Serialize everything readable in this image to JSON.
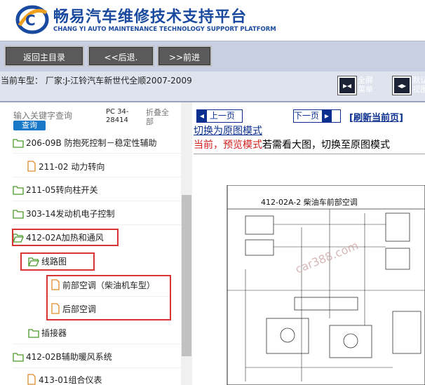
{
  "header": {
    "title": "畅易汽车维修技术支持平台",
    "subtitle": "CHANG YI AUTO MAINTENANCE TECHNOLOGY SUPPORT PLATFORM"
  },
  "nav": {
    "home": "返回主目录",
    "back": "<<后退.",
    "forward": ">>前进"
  },
  "status": {
    "car_type": "当前车型：  厂家:J-江铃汽车新世代全顺2007-2009",
    "fullscreen_1": "全屏",
    "fullscreen_2": "菜单",
    "default_1": "默认",
    "default_2": "视图"
  },
  "sidebar": {
    "search_placeholder": "输入关键字查询",
    "search_button": "查询",
    "pc_line1": "PC 34-",
    "pc_line2": "28414",
    "fold_line1": "折叠全",
    "fold_line2": "部",
    "items": [
      {
        "label": "206-09B 防抱死控制－稳定性辅助"
      },
      {
        "label": "211-02 动力转向"
      },
      {
        "label": "211-05转向柱开关"
      },
      {
        "label": "303-14发动机电子控制"
      },
      {
        "label": "412-02A加热和通风"
      },
      {
        "label": "线路图"
      },
      {
        "label": "前部空调（柴油机车型）"
      },
      {
        "label": "后部空调"
      },
      {
        "label": "插接器"
      },
      {
        "label": "412-02B辅助暖风系统"
      },
      {
        "label": "413-01组合仪表"
      }
    ]
  },
  "content": {
    "prev_page": "上一页",
    "next_page": "下一页",
    "refresh": "[刷新当前页]",
    "switch_link": "切换为原图模式",
    "preview_red": "当前，预览模式",
    "preview_rest": "若需看大图，切换至原图模式",
    "diagram_title": "412-02A-2  柴油车前部空调",
    "watermark": "car388.com"
  },
  "colors": {
    "brand_blue": "#1a4aa0",
    "highlight_red": "#d93434",
    "folder_green": "#4a9a2a",
    "file_orange": "#e08a2a"
  }
}
